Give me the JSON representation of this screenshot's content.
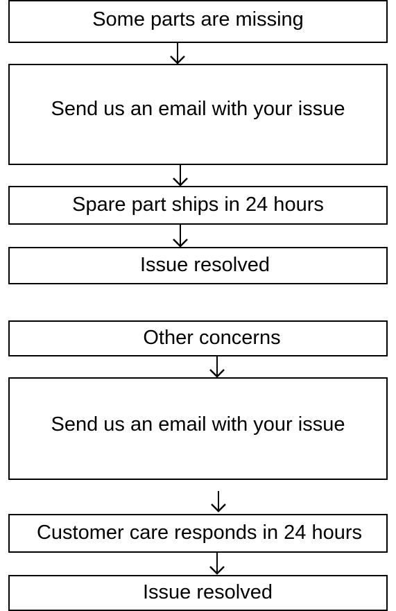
{
  "flow_1": {
    "step_1": "Some parts are missing",
    "step_2": "Send us an email with your issue",
    "step_3": "Spare part ships in 24 hours",
    "step_4": "Issue resolved"
  },
  "flow_2": {
    "step_1": "Other concerns",
    "step_2": "Send us an email with your issue",
    "step_3": "Customer care responds in 24 hours",
    "step_4": "Issue resolved"
  }
}
